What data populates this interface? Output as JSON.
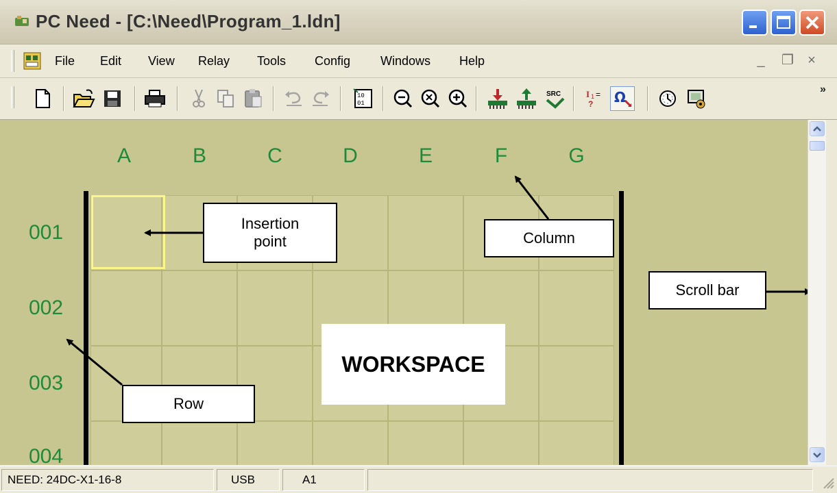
{
  "window": {
    "title": "PC Need - [C:\\Need\\Program_1.ldn]"
  },
  "menu": {
    "items": [
      "File",
      "Edit",
      "View",
      "Relay",
      "Tools",
      "Config",
      "Windows",
      "Help"
    ],
    "mdi_min": "_",
    "mdi_restore": "❐",
    "mdi_close": "×"
  },
  "toolbar": {
    "icons": [
      "new-file-icon",
      "open-folder-icon",
      "save-disk-icon",
      "print-icon",
      "cut-icon",
      "copy-icon",
      "paste-icon",
      "undo-icon",
      "redo-icon",
      "binary-table-icon",
      "zoom-out-icon",
      "zoom-reset-icon",
      "zoom-in-icon",
      "download-to-relay-icon",
      "upload-from-relay-icon",
      "source-icon",
      "input-status-icon",
      "ohm-test-icon",
      "clock-icon",
      "settings-monitor-icon"
    ],
    "overflow": "»"
  },
  "workspace": {
    "columns": [
      "A",
      "B",
      "C",
      "D",
      "E",
      "F",
      "G"
    ],
    "rows": [
      "001",
      "002",
      "003",
      "004"
    ],
    "label": "WORKSPACE",
    "selected_cell": "A1"
  },
  "callouts": {
    "insertion_point": [
      "Insertion",
      "point"
    ],
    "column": "Column",
    "scroll_bar": "Scroll bar",
    "row": "Row"
  },
  "colors": {
    "grid_background": "#c7c690",
    "header_text": "#1f8a3a",
    "insertion_cursor": "#fbf68a"
  },
  "statusbar": {
    "device": "NEED: 24DC-X1-16-8",
    "connection": "USB",
    "cell": "A1"
  }
}
